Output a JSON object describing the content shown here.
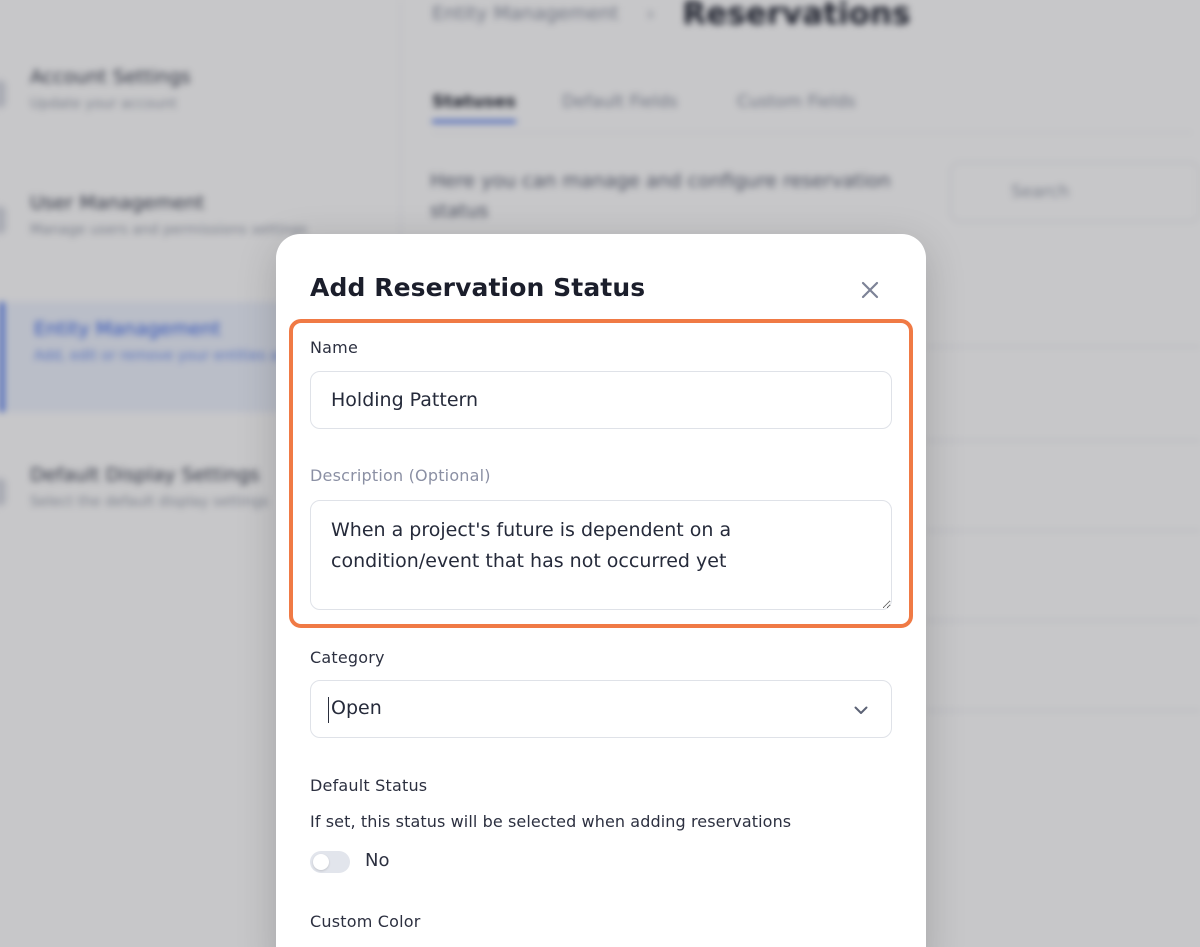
{
  "background": {
    "sidebar": {
      "items": [
        {
          "title": "Account Settings",
          "subtitle": "Update your account"
        },
        {
          "title": "User Management",
          "subtitle": "Manage users and permissions settings"
        },
        {
          "title": "Entity Management",
          "subtitle": "Add, edit or remove your entities and fields",
          "active": true
        },
        {
          "title": "Default Display Settings",
          "subtitle": "Select the default display settings"
        }
      ]
    },
    "breadcrumb": {
      "parent": "Entity Management",
      "separator": "›",
      "current": "Reservations"
    },
    "tabs": [
      {
        "label": "Statuses",
        "active": true
      },
      {
        "label": "Default Fields"
      },
      {
        "label": "Custom Fields"
      }
    ],
    "description": "Here you can manage and configure reservation status",
    "search": {
      "placeholder": "Search"
    }
  },
  "modal": {
    "title": "Add Reservation Status",
    "close_icon": "close-icon",
    "name": {
      "label": "Name",
      "value": "Holding Pattern"
    },
    "description": {
      "label": "Description (Optional)",
      "value": "When a project's future is dependent on a condition/event that has not occurred yet"
    },
    "category": {
      "label": "Category",
      "value": "Open"
    },
    "default_status": {
      "label": "Default Status",
      "helper": "If set, this status will be selected when adding reservations",
      "toggle_on": false,
      "toggle_label": "No"
    },
    "custom_color": {
      "label": "Custom Color"
    }
  },
  "colors": {
    "highlight": "#f07a45",
    "accent": "#3563e9",
    "title": "#1b1e2b"
  }
}
